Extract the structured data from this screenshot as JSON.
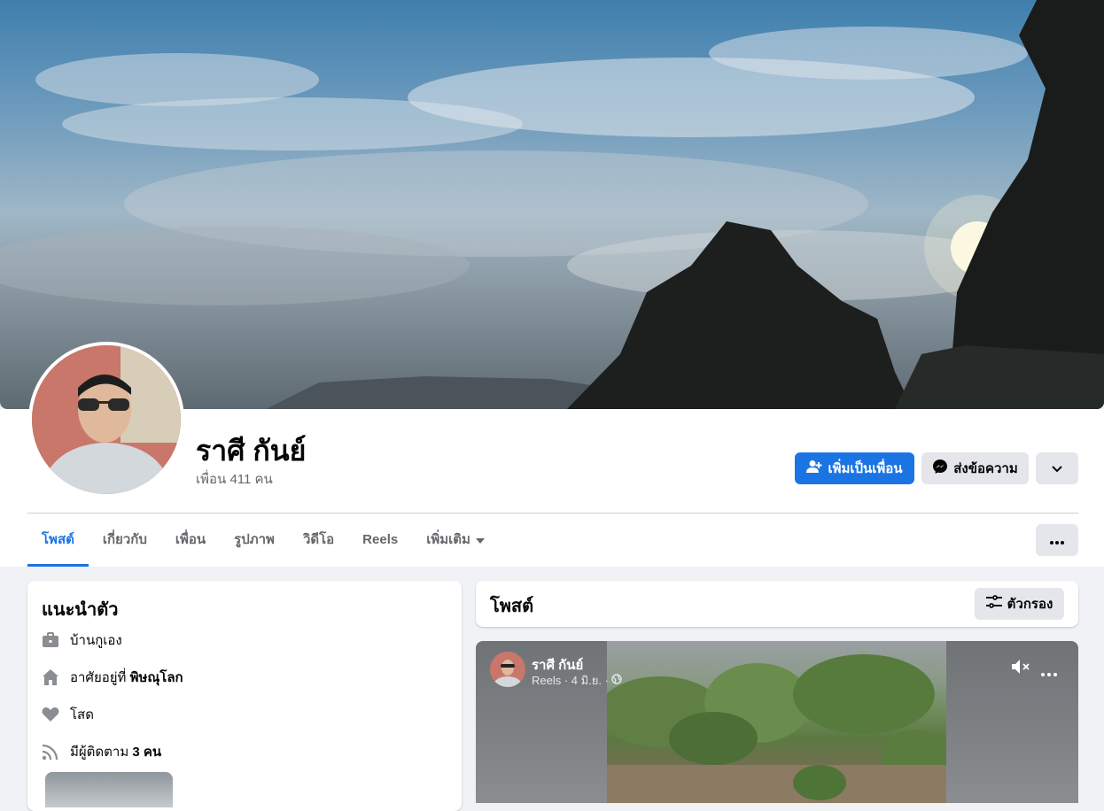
{
  "profile": {
    "name": "ราศี กันย์",
    "friends": "เพื่อน 411 คน"
  },
  "actions": {
    "add_friend": "เพิ่มเป็นเพื่อน",
    "message": "ส่งข้อความ"
  },
  "tabs": [
    {
      "label": "โพสต์",
      "active": true
    },
    {
      "label": "เกี่ยวกับ",
      "active": false
    },
    {
      "label": "เพื่อน",
      "active": false
    },
    {
      "label": "รูปภาพ",
      "active": false
    },
    {
      "label": "วิดีโอ",
      "active": false
    },
    {
      "label": "Reels",
      "active": false
    },
    {
      "label": "เพิ่มเติม",
      "active": false
    }
  ],
  "intro": {
    "title": "แนะนำตัว",
    "workplace": "บ้านกูเอง",
    "lives_prefix": "อาศัยอยู่ที่ ",
    "lives_city": "พิษณุโลก",
    "relationship": "โสด",
    "followers_prefix": "มีผู้ติดตาม ",
    "followers_count": "3 คน"
  },
  "posts": {
    "title": "โพสต์",
    "filter_label": "ตัวกรอง"
  },
  "reel_post": {
    "author": "ราศี กันย์",
    "meta": "Reels · 4 มิ.ย. ·"
  },
  "colors": {
    "accent": "#1b74e4",
    "secondary_button": "#e4e6eb",
    "page_bg": "#f0f2f5",
    "muted_text": "#65676b"
  },
  "icons": [
    "add-friend-icon",
    "messenger-icon",
    "chevron-down-icon",
    "more-icon",
    "briefcase-icon",
    "home-icon",
    "heart-icon",
    "rss-icon",
    "filter-icon",
    "mute-icon",
    "globe-icon"
  ]
}
